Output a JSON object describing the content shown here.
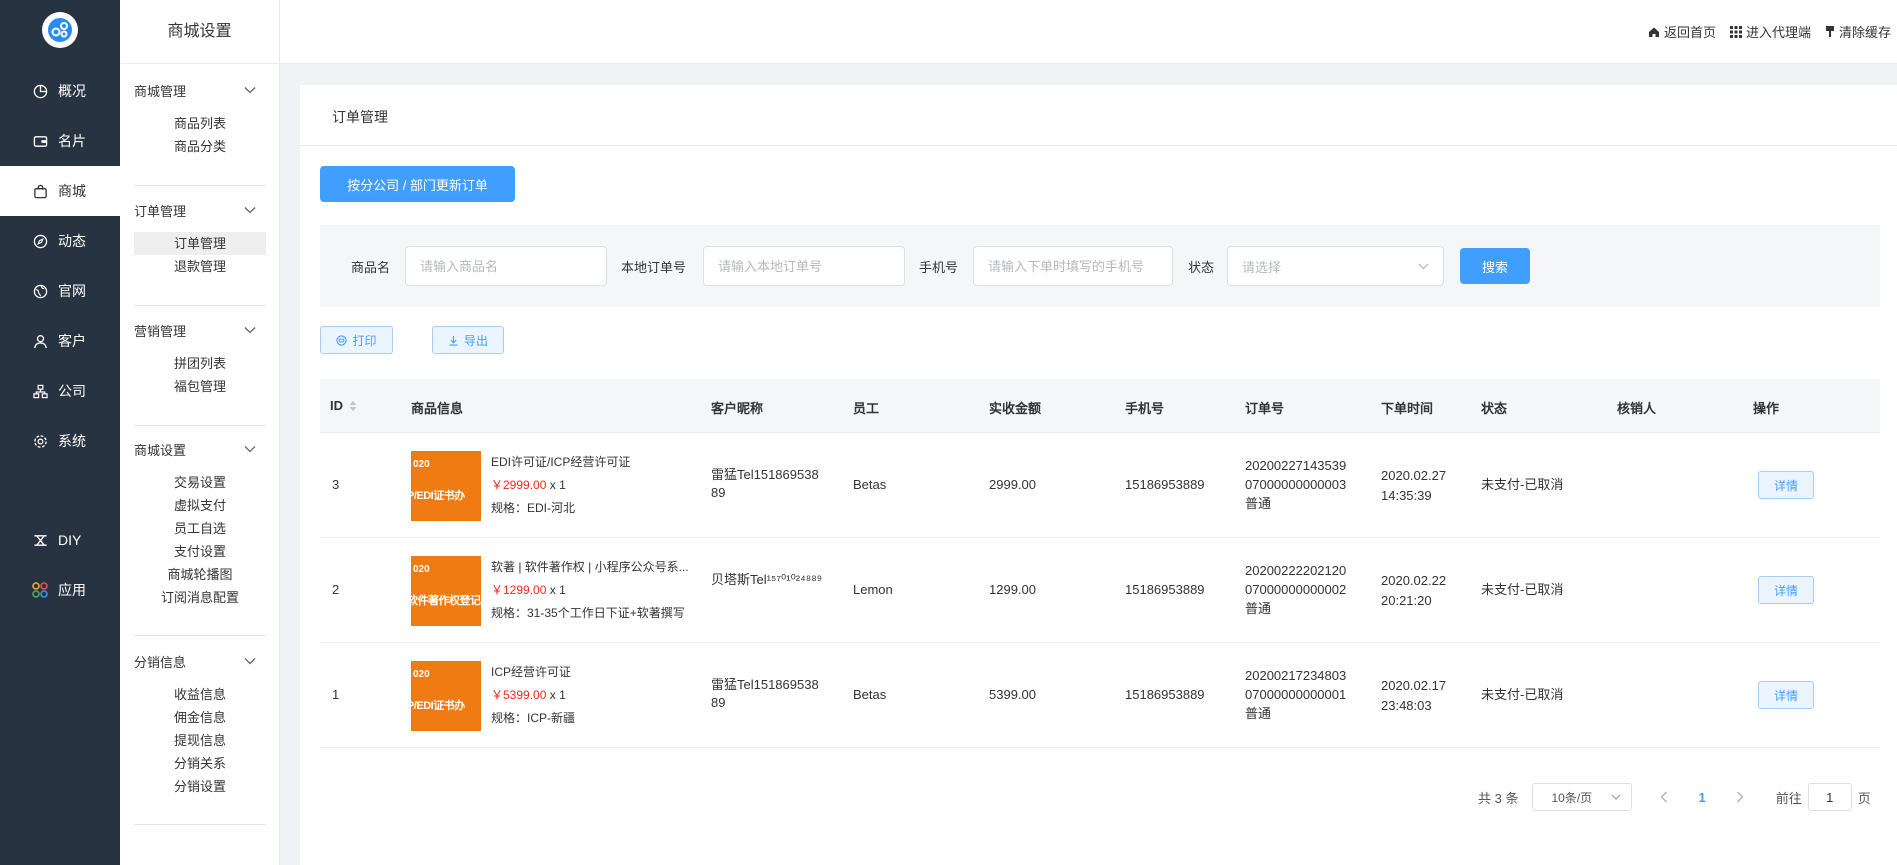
{
  "nav": {
    "items": [
      {
        "label": "概况",
        "icon": "pie-chart-icon"
      },
      {
        "label": "名片",
        "icon": "wallet-icon"
      },
      {
        "label": "商城",
        "icon": "shopping-bag-icon"
      },
      {
        "label": "动态",
        "icon": "compass-icon"
      },
      {
        "label": "官网",
        "icon": "globe-icon"
      },
      {
        "label": "客户",
        "icon": "user-icon"
      },
      {
        "label": "公司",
        "icon": "org-chart-icon"
      },
      {
        "label": "系统",
        "icon": "gear-icon"
      },
      {
        "label": "DIY",
        "icon": "diy-icon"
      },
      {
        "label": "应用",
        "icon": "apps-icon"
      }
    ],
    "active_index": 2
  },
  "side": {
    "title": "商城设置",
    "groups": [
      {
        "title": "商城管理",
        "items": [
          "商品列表",
          "商品分类"
        ]
      },
      {
        "title": "订单管理",
        "items": [
          "订单管理",
          "退款管理"
        ]
      },
      {
        "title": "营销管理",
        "items": [
          "拼团列表",
          "福包管理"
        ]
      },
      {
        "title": "商城设置",
        "items": [
          "交易设置",
          "虚拟支付",
          "员工自选",
          "支付设置",
          "商城轮播图",
          "订阅消息配置"
        ]
      },
      {
        "title": "分销信息",
        "items": [
          "收益信息",
          "佣金信息",
          "提现信息",
          "分销关系",
          "分销设置"
        ]
      }
    ],
    "active_item": "订单管理"
  },
  "topbar": {
    "home": "返回首页",
    "agent": "进入代理端",
    "cache": "清除缓存"
  },
  "page": {
    "breadcrumb": "订单管理",
    "update_button": "按分公司 / 部门更新订单"
  },
  "filter": {
    "product_label": "商品名",
    "product_placeholder": "请输入商品名",
    "order_label": "本地订单号",
    "order_placeholder": "请输入本地订单号",
    "phone_label": "手机号",
    "phone_placeholder": "请输入下单时填写的手机号",
    "status_label": "状态",
    "status_placeholder": "请选择",
    "search_button": "搜索"
  },
  "actions": {
    "print": "打印",
    "export": "导出"
  },
  "table": {
    "headers": {
      "id": "ID",
      "product": "商品信息",
      "customer": "客户昵称",
      "staff": "员工",
      "amount": "实收金额",
      "phone": "手机号",
      "order_no": "订单号",
      "time": "下单时间",
      "status": "状态",
      "verifier": "核销人",
      "op": "操作"
    },
    "rows": [
      {
        "id": "3",
        "thumb_top": "020",
        "thumb_bottom": "P/EDI证书办",
        "name": "EDI许可证/ICP经营许可证",
        "price": "￥2999.00",
        "qty": "x 1",
        "spec": "规格：EDI-河北",
        "customer_1": "雷猛Tel151869538",
        "customer_2": "89",
        "staff": "Betas",
        "amount": "2999.00",
        "phone": "15186953889",
        "order_1": "20200227143539",
        "order_2": "07000000000003",
        "order_3": "普通",
        "date": "2020.02.27",
        "time": "14:35:39",
        "status": "未支付-已取消",
        "detail": "详情"
      },
      {
        "id": "2",
        "thumb_top": "020",
        "thumb_bottom": "软件著作权登记",
        "name": "软著 | 软件著作权 | 小程序公众号系...",
        "price": "￥1299.00",
        "qty": "x 1",
        "spec": "规格：31-35个工作日下证+软著撰写",
        "customer_1": "贝塔斯Tel¹⁵⁷⁰¹⁰²⁴⁸⁸⁹",
        "customer_2": "",
        "staff": "Lemon",
        "amount": "1299.00",
        "phone": "15186953889",
        "order_1": "20200222202120",
        "order_2": "07000000000002",
        "order_3": "普通",
        "date": "2020.02.22",
        "time": "20:21:20",
        "status": "未支付-已取消",
        "detail": "详情"
      },
      {
        "id": "1",
        "thumb_top": "020",
        "thumb_bottom": "P/EDI证书办",
        "name": "ICP经营许可证",
        "price": "￥5399.00",
        "qty": "x 1",
        "spec": "规格：ICP-新疆",
        "customer_1": "雷猛Tel151869538",
        "customer_2": "89",
        "staff": "Betas",
        "amount": "5399.00",
        "phone": "15186953889",
        "order_1": "20200217234803",
        "order_2": "07000000000001",
        "order_3": "普通",
        "date": "2020.02.17",
        "time": "23:48:03",
        "status": "未支付-已取消",
        "detail": "详情"
      }
    ]
  },
  "pagination": {
    "total": "共 3 条",
    "page_size": "10条/页",
    "current_page": "1",
    "goto_prefix": "前往",
    "goto_value": "1",
    "goto_suffix": "页"
  },
  "colors": {
    "nav_bg": "#283341",
    "primary": "#409eff",
    "price": "#f0281e",
    "thumb": "#f07b12"
  }
}
